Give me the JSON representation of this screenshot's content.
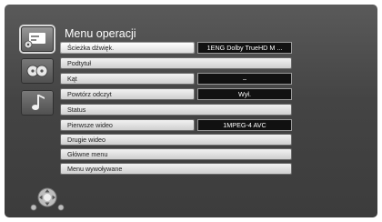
{
  "title": "Menu operacji",
  "icons": {
    "top": "disc-player-icon",
    "middle": "audio-reels-icon",
    "bottom": "music-note-icon",
    "nav": "remote-navigation-icon"
  },
  "rows": [
    {
      "label": "Ścieżka dźwięk.",
      "value": "1ENG Dolby TrueHD M ..."
    },
    {
      "label": "Podtytuł"
    },
    {
      "label": "Kąt",
      "value": "–"
    },
    {
      "label": "Powtórz odczyt",
      "value": "Wył."
    },
    {
      "label": "Status"
    },
    {
      "label": "Pierwsze wideo",
      "value": "1MPEG-4 AVC"
    },
    {
      "label": "Drugie wideo"
    },
    {
      "label": "Główne menu"
    },
    {
      "label": "Menu wywoływane"
    }
  ]
}
